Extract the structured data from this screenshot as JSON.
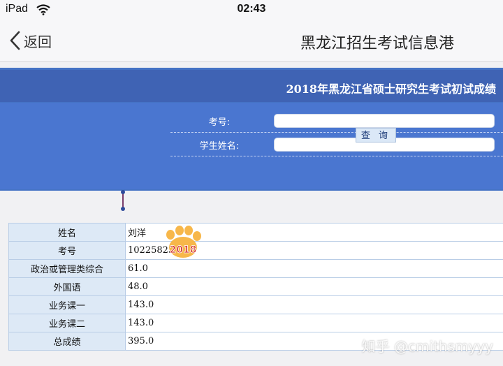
{
  "status_bar": {
    "device": "iPad",
    "time": "02:43"
  },
  "nav": {
    "back_label": "返回",
    "title": "黑龙江招生考试信息港"
  },
  "panel": {
    "title": "2018年黑龙江省硕士研究生考试初试成绩",
    "fields": [
      {
        "label": "考号:",
        "value": ""
      },
      {
        "label": "学生姓名:",
        "value": ""
      }
    ],
    "query_label": "查 询"
  },
  "results": [
    {
      "label": "姓名",
      "value": "刘洋"
    },
    {
      "label": "考号",
      "value": "1022582300"
    },
    {
      "label": "政治或管理类综合",
      "value": "61.0"
    },
    {
      "label": "外国语",
      "value": "48.0"
    },
    {
      "label": "业务课一",
      "value": "143.0"
    },
    {
      "label": "业务课二",
      "value": "143.0"
    },
    {
      "label": "总成绩",
      "value": "395.0"
    }
  ],
  "sticker_text": "2018",
  "watermark": "知乎 @cmithsmyyy",
  "colors": {
    "panel_blue": "#4472c4",
    "header_blue": "#3f63b4",
    "label_cell": "#dde9f6"
  }
}
